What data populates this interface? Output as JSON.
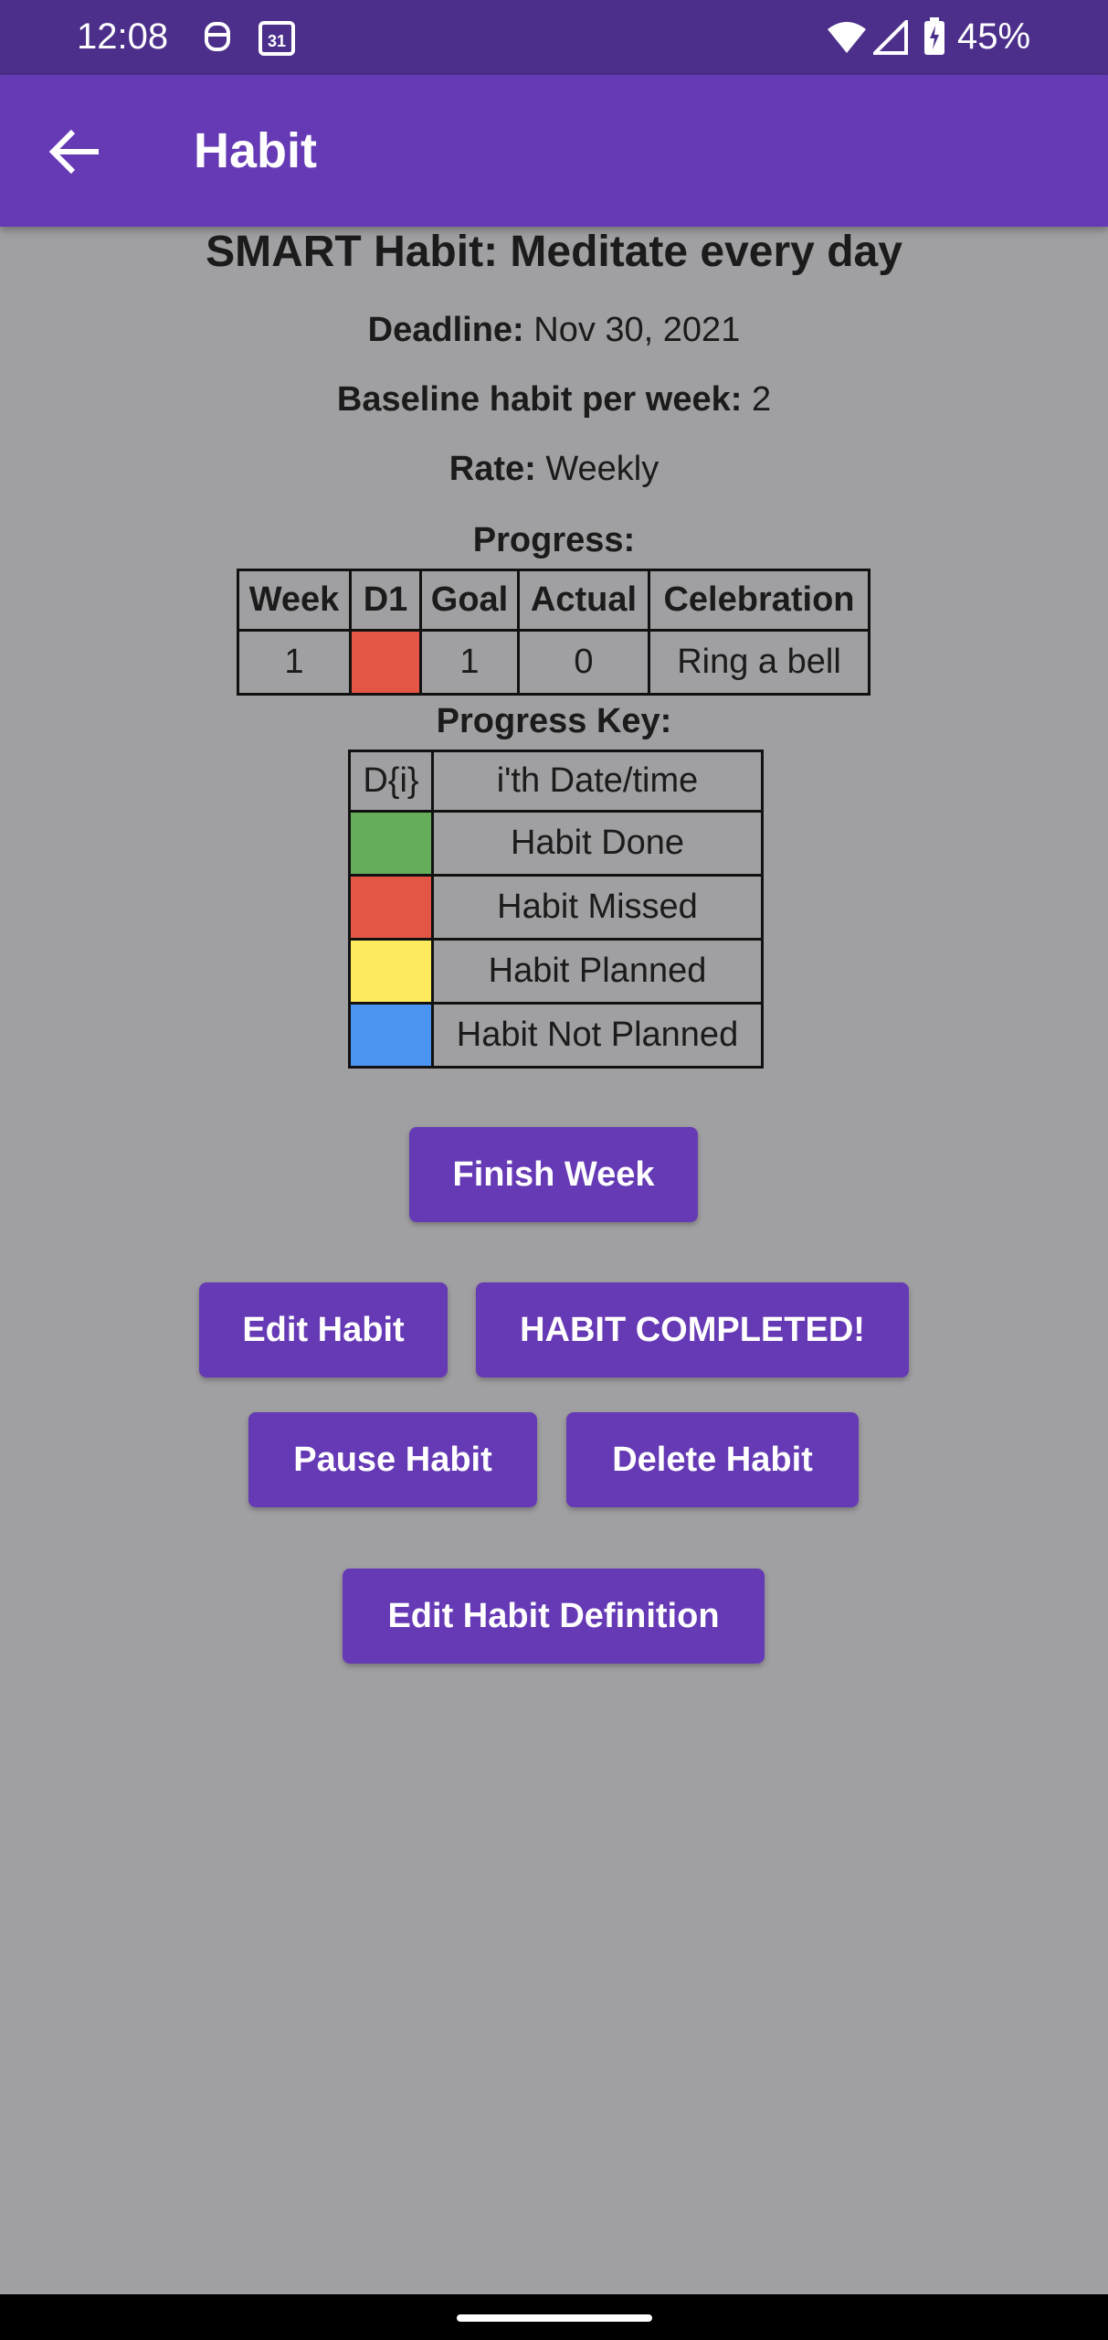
{
  "status_bar": {
    "time": "12:08",
    "calendar_date": "31",
    "battery_percent": "45%"
  },
  "app_bar": {
    "title": "Habit"
  },
  "habit": {
    "title": "SMART Habit: Meditate every day",
    "deadline_label": "Deadline:",
    "deadline_value": " Nov 30, 2021",
    "baseline_label": "Baseline habit per week:",
    "baseline_value": " 2",
    "rate_label": "Rate:",
    "rate_value": " Weekly"
  },
  "progress": {
    "heading": "Progress:",
    "headers": [
      "Week",
      "D1",
      "Goal",
      "Actual",
      "Celebration"
    ],
    "row": {
      "week": "1",
      "d1_status": "missed",
      "goal": "1",
      "actual": "0",
      "celebration": "Ring a bell"
    }
  },
  "progress_key": {
    "heading": "Progress Key:",
    "rows": [
      {
        "key": "D{i}",
        "label": "i'th Date/time"
      },
      {
        "color": "#66ad5b",
        "label": "Habit Done"
      },
      {
        "color": "#e35544",
        "label": "Habit Missed"
      },
      {
        "color": "#fdea5f",
        "label": "Habit Planned"
      },
      {
        "color": "#4b94ef",
        "label": "Habit Not Planned"
      }
    ]
  },
  "buttons": {
    "finish_week": "Finish Week",
    "edit_habit": "Edit Habit",
    "habit_completed": "HABIT COMPLETED!",
    "pause_habit": "Pause Habit",
    "delete_habit": "Delete Habit",
    "edit_habit_definition": "Edit Habit Definition"
  },
  "colors": {
    "primary": "#663ab5",
    "status_bar": "#4b2f8a",
    "background": "#a09fa2",
    "missed": "#e35544"
  },
  "icons": {
    "back": "arrow-left-icon",
    "wifi": "wifi-icon",
    "signal": "signal-icon",
    "battery": "battery-icon"
  }
}
